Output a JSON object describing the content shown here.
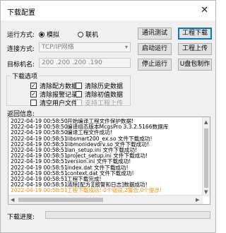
{
  "window": {
    "title": "下载配置",
    "close_glyph": "✕"
  },
  "run_mode": {
    "label": "运行方式:",
    "options": [
      "模拟",
      "联机"
    ],
    "selected": "模拟"
  },
  "conn_mode": {
    "label": "连接方式:",
    "value": "TCP/IP网络",
    "arrow": "▾"
  },
  "target": {
    "label": "目标机名:",
    "value": "200 .200 .200 .190"
  },
  "buttons": {
    "comm_test": "通讯测试",
    "download": "工程下载",
    "start": "启动运行",
    "upload": "工程上传",
    "stop": "停止运行",
    "udisk": "U盘包制作"
  },
  "options": {
    "title": "下载选项",
    "items": [
      {
        "label": "清除配方数据",
        "checked": true,
        "disabled": false
      },
      {
        "label": "清除历史数据",
        "checked": false,
        "disabled": false
      },
      {
        "label": "清除报警记录",
        "checked": true,
        "disabled": false
      },
      {
        "label": "清除初值数据",
        "checked": false,
        "disabled": false
      },
      {
        "label": "清空用户文件",
        "checked": false,
        "disabled": false
      },
      {
        "label": "支持工程上传",
        "checked": false,
        "disabled": true
      }
    ]
  },
  "log": {
    "label": "返回信息:",
    "rows": [
      {
        "time": "2022-04-19 00:58:50",
        "msg": "开始编译工程文件保护数据!",
        "color": "#000000"
      },
      {
        "time": "2022-04-19 00:58:50",
        "msg": "编译组态版本McgsPro 3.3.2.5166数据库",
        "color": "#000000"
      },
      {
        "time": "2022-04-19 00:58:50",
        "msg": "编译工程文件成功!",
        "color": "#000000"
      },
      {
        "time": "2022-04-19 00:58:51",
        "msg": "libsmart200_ex.so 文件下载成功!",
        "color": "#000000"
      },
      {
        "time": "2022-04-19 00:58:51",
        "msg": "libmonidevdrv.so 文件下载成功!",
        "color": "#000000"
      },
      {
        "time": "2022-04-19 00:58:51",
        "msg": "lan_setup.ini 文件下载成功!",
        "color": "#000000"
      },
      {
        "time": "2022-04-19 00:58:51",
        "msg": "project_setup.ini 文件下载成功!",
        "color": "#000000"
      },
      {
        "time": "2022-04-19 00:58:51",
        "msg": "version.ini 文件下载成功!",
        "color": "#000000"
      },
      {
        "time": "2022-04-19 00:58:51",
        "msg": "index.dat 文件下载成功!",
        "color": "#000000"
      },
      {
        "time": "2022-04-19 00:58:51",
        "msg": "context.dat 文件下载成功!",
        "color": "#000000"
      },
      {
        "time": "2022-04-19 00:58:51",
        "msg": "工程下载完成!",
        "color": "#000000"
      },
      {
        "time": "2022-04-19 00:58:51",
        "msg": "清除[配方][报警和日志]数据成功!",
        "color": "#000000"
      },
      {
        "time": "2022-04-19 00:58:51",
        "msg": "工程下载成功! 0个错误,2警告,0个提示!",
        "color": "#ff8c00"
      }
    ]
  },
  "scroll": {
    "up": "▲",
    "down": "▼",
    "left": "◀",
    "right": "▶"
  },
  "progress": {
    "label": "下载进度:",
    "value": 0
  }
}
